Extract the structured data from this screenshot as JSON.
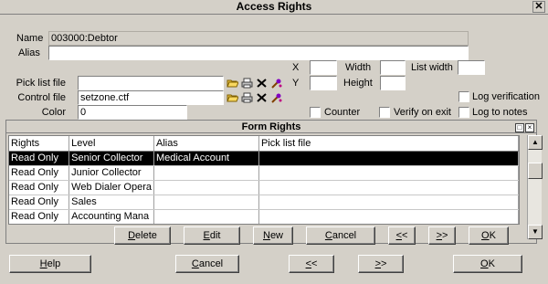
{
  "window": {
    "title": "Access Rights"
  },
  "fields": {
    "name_label": "Name",
    "name_value": "003000:Debtor",
    "alias_label": "Alias",
    "alias_value": "",
    "pick_list_label": "Pick list file",
    "pick_list_value": "",
    "control_file_label": "Control file",
    "control_file_value": "setzone.ctf",
    "color_label": "Color",
    "color_value": "0",
    "x_label": "X",
    "x_value": "",
    "y_label": "Y",
    "y_value": "",
    "width_label": "Width",
    "width_value": "",
    "height_label": "Height",
    "height_value": "",
    "list_width_label": "List width",
    "list_width_value": ""
  },
  "checkboxes": {
    "log_verification": "Log verification",
    "counter": "Counter",
    "verify_on_exit": "Verify on exit",
    "log_to_notes": "Log to notes"
  },
  "form_rights": {
    "title": "Form Rights",
    "columns": [
      "Rights",
      "Level",
      "Alias",
      "Pick list file"
    ],
    "rows": [
      [
        "Read Only",
        "Senior Collector",
        "Medical Account",
        ""
      ],
      [
        "Read Only",
        "Junior Collector",
        "",
        ""
      ],
      [
        "Read Only",
        "Web Dialer Opera",
        "",
        ""
      ],
      [
        "Read Only",
        "Sales",
        "",
        ""
      ],
      [
        "Read Only",
        "Accounting Mana",
        "",
        ""
      ]
    ],
    "buttons": {
      "delete": {
        "u": "D",
        "rest": "elete"
      },
      "edit": {
        "u": "E",
        "rest": "dit"
      },
      "new": {
        "u": "N",
        "rest": "ew"
      },
      "cancel": {
        "u": "C",
        "rest": "ancel"
      },
      "prev": {
        "u": "<",
        "rest": "<"
      },
      "next": {
        "u": ">",
        "rest": ">"
      },
      "ok": {
        "u": "O",
        "rest": "K"
      }
    }
  },
  "footer": {
    "help": {
      "u": "H",
      "rest": "elp"
    },
    "cancel": {
      "u": "C",
      "rest": "ancel"
    },
    "prev": {
      "u": "<",
      "rest": "<"
    },
    "next": {
      "u": ">",
      "rest": ">"
    },
    "ok": {
      "u": "O",
      "rest": "K"
    }
  },
  "icons": [
    "open-folder-icon",
    "printer-icon",
    "delete-x-icon",
    "wizard-icon"
  ]
}
